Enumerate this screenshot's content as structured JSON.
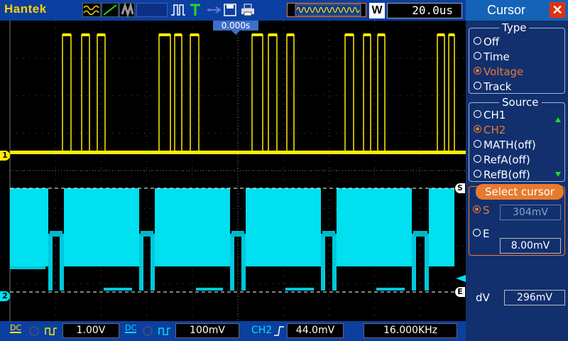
{
  "brand": "Hantek",
  "timebase": "20.0us",
  "trigger_pos": "0.000s",
  "waveform_mode_letter": "W",
  "panel": {
    "title": "Cursor",
    "type_label": "Type",
    "type_options": [
      "Off",
      "Time",
      "Voltage",
      "Track"
    ],
    "type_selected": 2,
    "source_label": "Source",
    "source_options": [
      "CH1",
      "CH2",
      "MATH(off)",
      "RefA(off)",
      "RefB(off)"
    ],
    "source_selected": 1,
    "select_label": "Select cursor",
    "s_label": "S",
    "s_value": "304mV",
    "e_label": "E",
    "e_value": "8.00mV",
    "dv_label": "dV",
    "dv_value": "296mV"
  },
  "bottom": {
    "ch1_scale": "1.00V",
    "ch2_scale": "100mV",
    "trig_source": "CH2",
    "trig_level": "44.0mV",
    "frequency": "16.000KHz",
    "coupling": "DC"
  },
  "markers": {
    "ch1": "1",
    "ch2": "2",
    "cursor_s": "S",
    "cursor_e": "E"
  },
  "colors": {
    "ch1": "#ffee00",
    "ch2": "#00e0f0",
    "accent": "#e87a30",
    "bar": "#0b3fa0"
  }
}
